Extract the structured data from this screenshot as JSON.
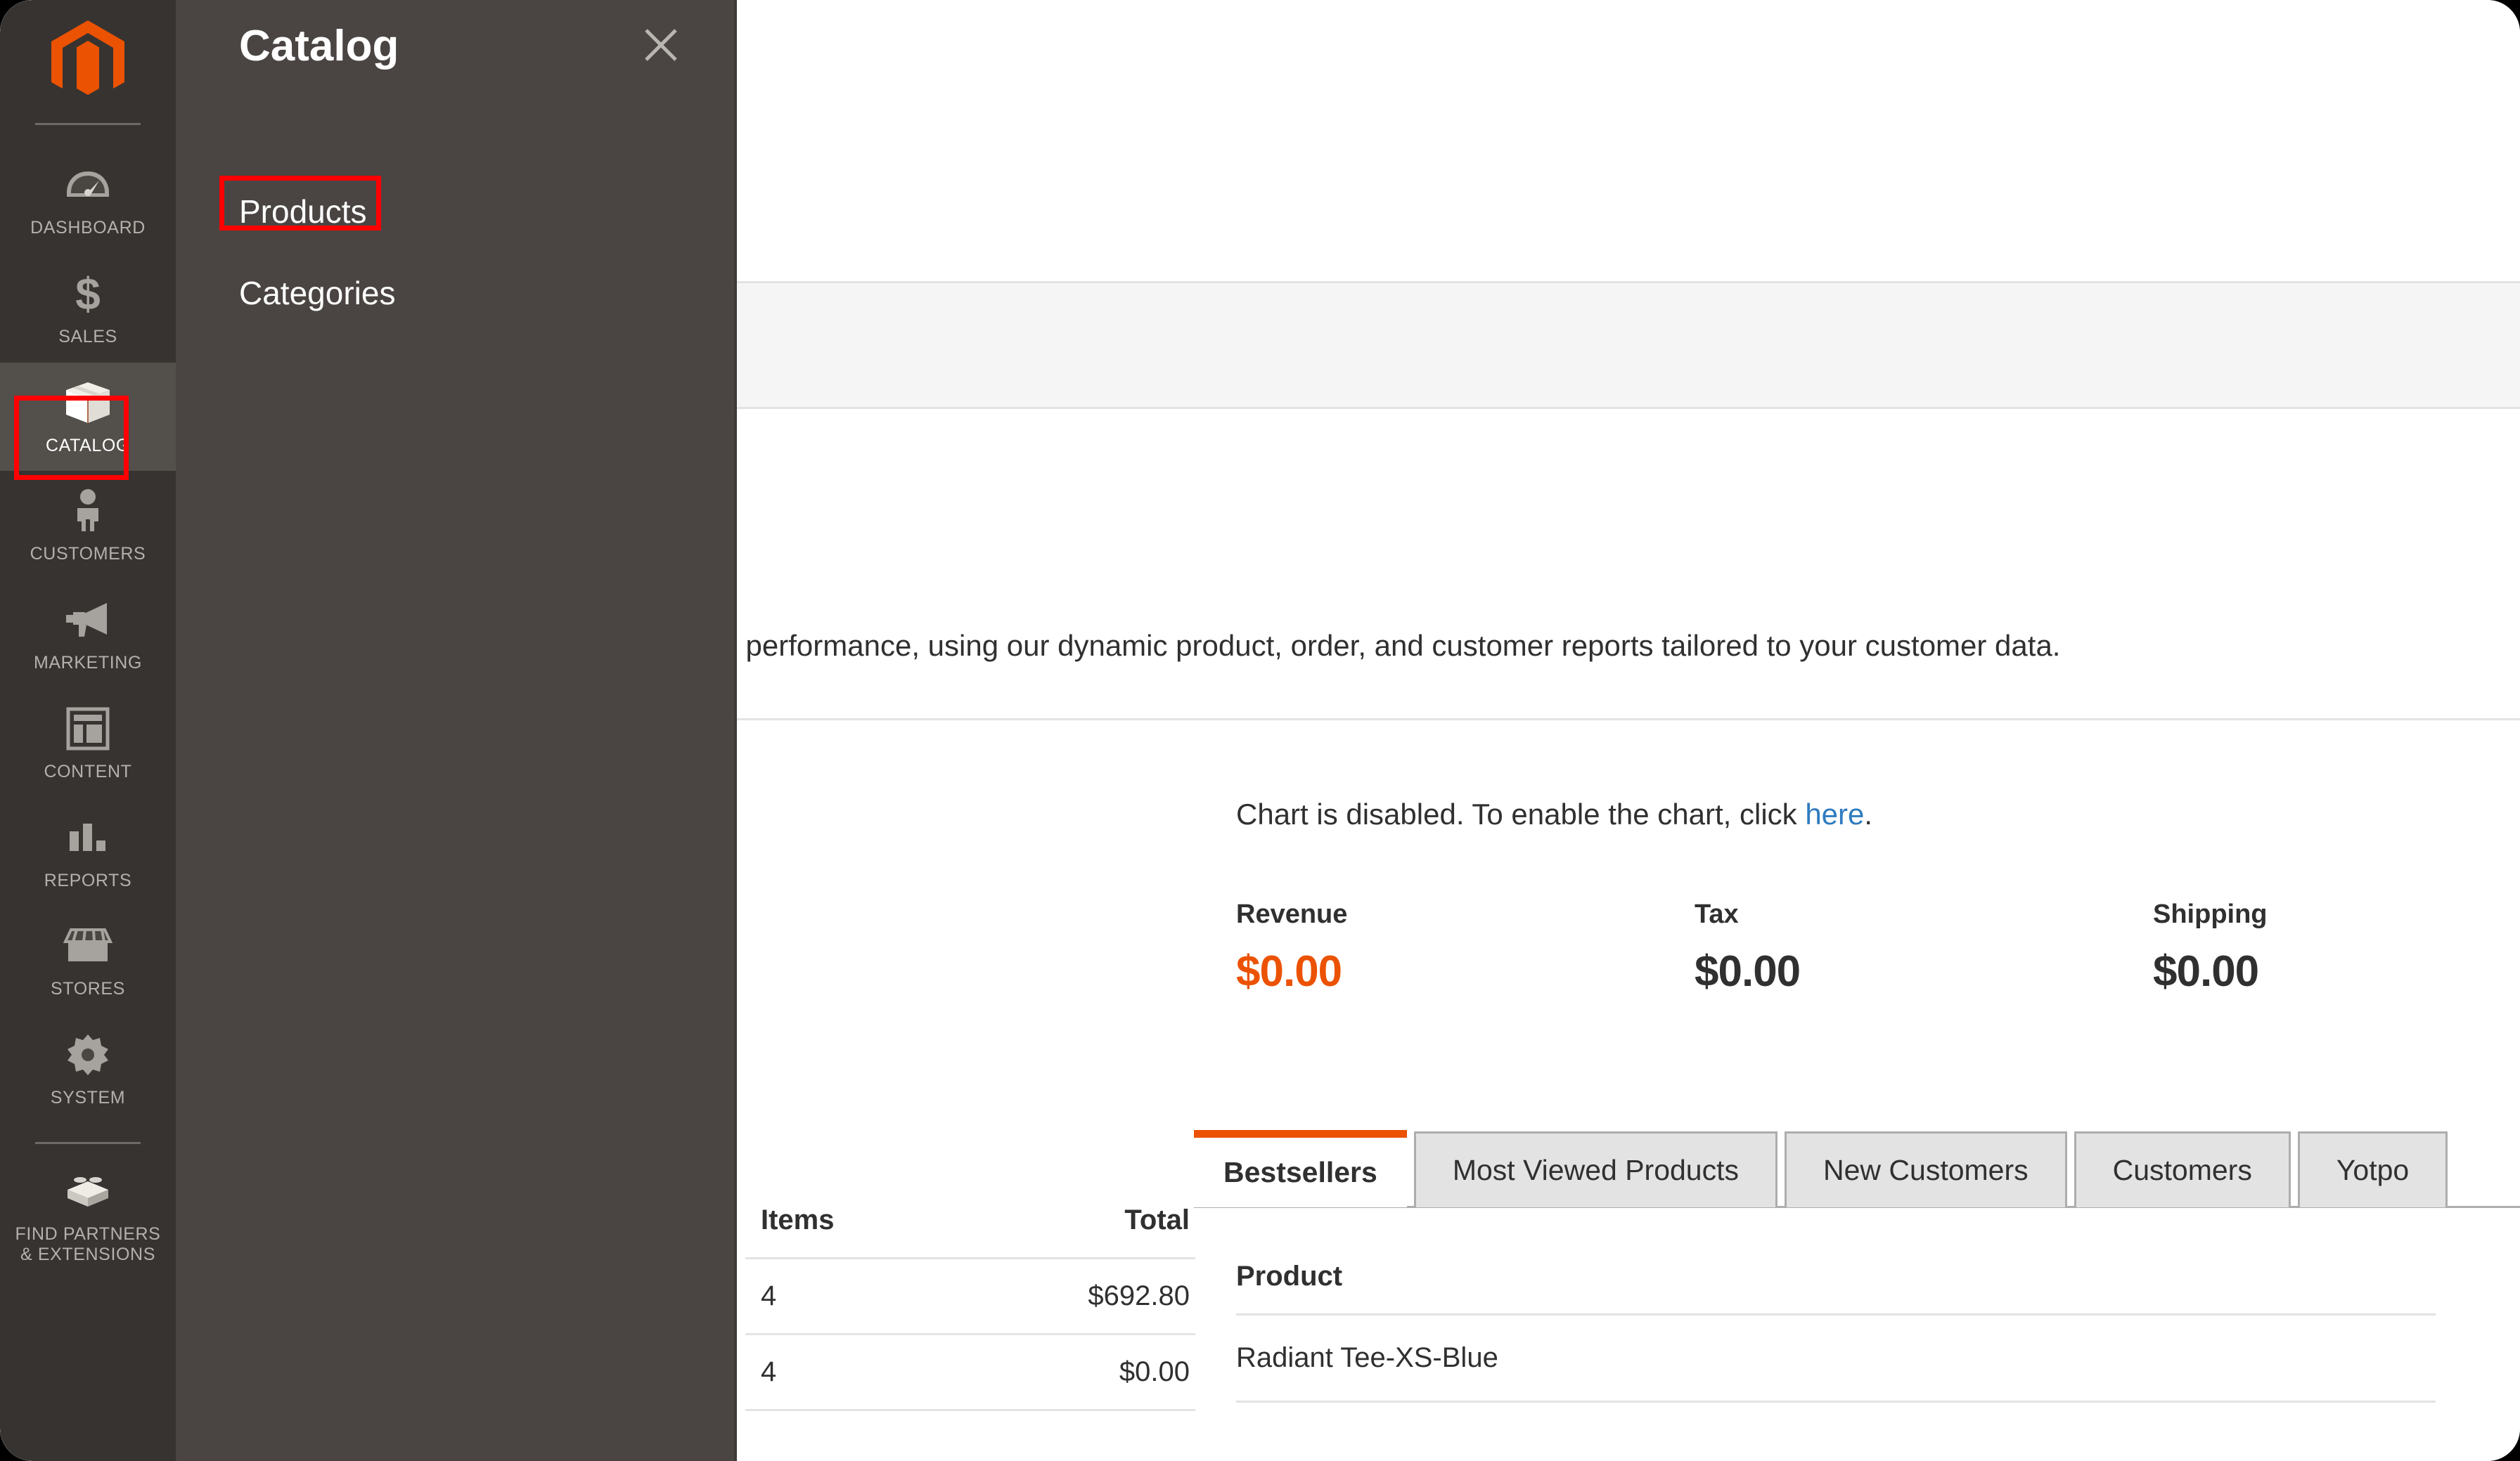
{
  "sidebar": {
    "logo_icon": "magento-logo-icon",
    "items": [
      {
        "label": "DASHBOARD",
        "icon": "dashboard-gauge-icon",
        "active": false
      },
      {
        "label": "SALES",
        "icon": "dollar-sign-icon",
        "active": false
      },
      {
        "label": "CATALOG",
        "icon": "box-package-icon",
        "active": true
      },
      {
        "label": "CUSTOMERS",
        "icon": "person-icon",
        "active": false
      },
      {
        "label": "MARKETING",
        "icon": "megaphone-icon",
        "active": false
      },
      {
        "label": "CONTENT",
        "icon": "layout-page-icon",
        "active": false
      },
      {
        "label": "REPORTS",
        "icon": "bar-chart-icon",
        "active": false
      },
      {
        "label": "STORES",
        "icon": "storefront-icon",
        "active": false
      },
      {
        "label": "SYSTEM",
        "icon": "gear-icon",
        "active": false
      }
    ],
    "footer_item": {
      "label": "FIND PARTNERS\n& EXTENSIONS",
      "label_line1": "FIND PARTNERS",
      "label_line2": "& EXTENSIONS",
      "icon": "extension-brick-icon"
    }
  },
  "catalog_panel": {
    "title": "Catalog",
    "close_icon": "close-x-icon",
    "items": [
      {
        "label": "Products",
        "highlighted": true
      },
      {
        "label": "Categories",
        "highlighted": false
      }
    ]
  },
  "main": {
    "advanced_reporting_text": "d of your business' performance, using our dynamic product, order, and customer reports tailored to your customer data.",
    "chart_notice_prefix": "Chart is disabled. To enable the chart, click ",
    "chart_notice_link": "here",
    "chart_notice_suffix": ".",
    "metrics": [
      {
        "label": "Revenue",
        "value": "$0.00",
        "accent": true
      },
      {
        "label": "Tax",
        "value": "$0.00",
        "accent": false
      },
      {
        "label": "Shipping",
        "value": "$0.00",
        "accent": false
      }
    ],
    "tabs": [
      {
        "label": "Bestsellers",
        "active": true
      },
      {
        "label": "Most Viewed Products",
        "active": false
      },
      {
        "label": "New Customers",
        "active": false
      },
      {
        "label": "Customers",
        "active": false
      },
      {
        "label": "Yotpo",
        "active": false
      }
    ],
    "bestsellers": {
      "column_header": "Product",
      "rows": [
        {
          "product": "Radiant Tee-XS-Blue"
        }
      ]
    },
    "orders_table": {
      "columns": {
        "items": "Items",
        "total": "Total"
      },
      "rows": [
        {
          "items": "4",
          "total": "$692.80"
        },
        {
          "items": "4",
          "total": "$0.00"
        }
      ]
    }
  },
  "colors": {
    "accent_orange": "#eb5202",
    "sidebar_bg": "#373330",
    "panel_bg": "#4A4542",
    "highlight_red": "#ff0000",
    "link_blue": "#2f7bbf"
  }
}
